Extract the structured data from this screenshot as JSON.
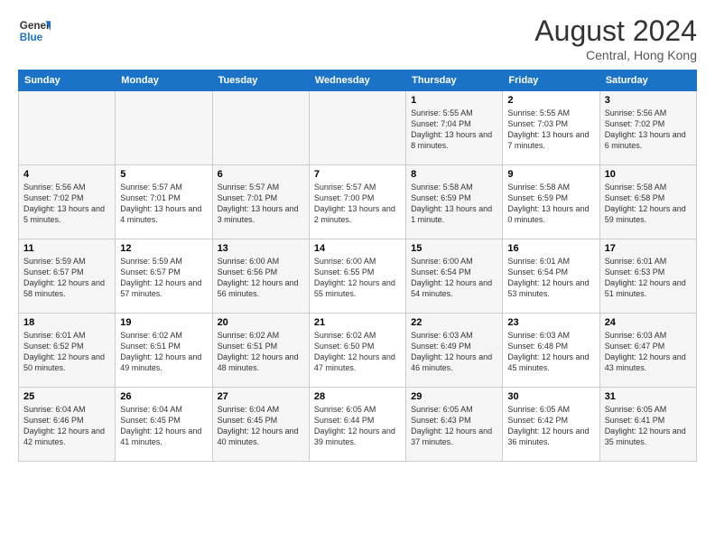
{
  "header": {
    "logo_line1": "General",
    "logo_line2": "Blue",
    "month": "August 2024",
    "location": "Central, Hong Kong"
  },
  "weekdays": [
    "Sunday",
    "Monday",
    "Tuesday",
    "Wednesday",
    "Thursday",
    "Friday",
    "Saturday"
  ],
  "weeks": [
    [
      {
        "day": "",
        "sunrise": "",
        "sunset": "",
        "daylight": ""
      },
      {
        "day": "",
        "sunrise": "",
        "sunset": "",
        "daylight": ""
      },
      {
        "day": "",
        "sunrise": "",
        "sunset": "",
        "daylight": ""
      },
      {
        "day": "",
        "sunrise": "",
        "sunset": "",
        "daylight": ""
      },
      {
        "day": "1",
        "sunrise": "Sunrise: 5:55 AM",
        "sunset": "Sunset: 7:04 PM",
        "daylight": "Daylight: 13 hours and 8 minutes."
      },
      {
        "day": "2",
        "sunrise": "Sunrise: 5:55 AM",
        "sunset": "Sunset: 7:03 PM",
        "daylight": "Daylight: 13 hours and 7 minutes."
      },
      {
        "day": "3",
        "sunrise": "Sunrise: 5:56 AM",
        "sunset": "Sunset: 7:02 PM",
        "daylight": "Daylight: 13 hours and 6 minutes."
      }
    ],
    [
      {
        "day": "4",
        "sunrise": "Sunrise: 5:56 AM",
        "sunset": "Sunset: 7:02 PM",
        "daylight": "Daylight: 13 hours and 5 minutes."
      },
      {
        "day": "5",
        "sunrise": "Sunrise: 5:57 AM",
        "sunset": "Sunset: 7:01 PM",
        "daylight": "Daylight: 13 hours and 4 minutes."
      },
      {
        "day": "6",
        "sunrise": "Sunrise: 5:57 AM",
        "sunset": "Sunset: 7:01 PM",
        "daylight": "Daylight: 13 hours and 3 minutes."
      },
      {
        "day": "7",
        "sunrise": "Sunrise: 5:57 AM",
        "sunset": "Sunset: 7:00 PM",
        "daylight": "Daylight: 13 hours and 2 minutes."
      },
      {
        "day": "8",
        "sunrise": "Sunrise: 5:58 AM",
        "sunset": "Sunset: 6:59 PM",
        "daylight": "Daylight: 13 hours and 1 minute."
      },
      {
        "day": "9",
        "sunrise": "Sunrise: 5:58 AM",
        "sunset": "Sunset: 6:59 PM",
        "daylight": "Daylight: 13 hours and 0 minutes."
      },
      {
        "day": "10",
        "sunrise": "Sunrise: 5:58 AM",
        "sunset": "Sunset: 6:58 PM",
        "daylight": "Daylight: 12 hours and 59 minutes."
      }
    ],
    [
      {
        "day": "11",
        "sunrise": "Sunrise: 5:59 AM",
        "sunset": "Sunset: 6:57 PM",
        "daylight": "Daylight: 12 hours and 58 minutes."
      },
      {
        "day": "12",
        "sunrise": "Sunrise: 5:59 AM",
        "sunset": "Sunset: 6:57 PM",
        "daylight": "Daylight: 12 hours and 57 minutes."
      },
      {
        "day": "13",
        "sunrise": "Sunrise: 6:00 AM",
        "sunset": "Sunset: 6:56 PM",
        "daylight": "Daylight: 12 hours and 56 minutes."
      },
      {
        "day": "14",
        "sunrise": "Sunrise: 6:00 AM",
        "sunset": "Sunset: 6:55 PM",
        "daylight": "Daylight: 12 hours and 55 minutes."
      },
      {
        "day": "15",
        "sunrise": "Sunrise: 6:00 AM",
        "sunset": "Sunset: 6:54 PM",
        "daylight": "Daylight: 12 hours and 54 minutes."
      },
      {
        "day": "16",
        "sunrise": "Sunrise: 6:01 AM",
        "sunset": "Sunset: 6:54 PM",
        "daylight": "Daylight: 12 hours and 53 minutes."
      },
      {
        "day": "17",
        "sunrise": "Sunrise: 6:01 AM",
        "sunset": "Sunset: 6:53 PM",
        "daylight": "Daylight: 12 hours and 51 minutes."
      }
    ],
    [
      {
        "day": "18",
        "sunrise": "Sunrise: 6:01 AM",
        "sunset": "Sunset: 6:52 PM",
        "daylight": "Daylight: 12 hours and 50 minutes."
      },
      {
        "day": "19",
        "sunrise": "Sunrise: 6:02 AM",
        "sunset": "Sunset: 6:51 PM",
        "daylight": "Daylight: 12 hours and 49 minutes."
      },
      {
        "day": "20",
        "sunrise": "Sunrise: 6:02 AM",
        "sunset": "Sunset: 6:51 PM",
        "daylight": "Daylight: 12 hours and 48 minutes."
      },
      {
        "day": "21",
        "sunrise": "Sunrise: 6:02 AM",
        "sunset": "Sunset: 6:50 PM",
        "daylight": "Daylight: 12 hours and 47 minutes."
      },
      {
        "day": "22",
        "sunrise": "Sunrise: 6:03 AM",
        "sunset": "Sunset: 6:49 PM",
        "daylight": "Daylight: 12 hours and 46 minutes."
      },
      {
        "day": "23",
        "sunrise": "Sunrise: 6:03 AM",
        "sunset": "Sunset: 6:48 PM",
        "daylight": "Daylight: 12 hours and 45 minutes."
      },
      {
        "day": "24",
        "sunrise": "Sunrise: 6:03 AM",
        "sunset": "Sunset: 6:47 PM",
        "daylight": "Daylight: 12 hours and 43 minutes."
      }
    ],
    [
      {
        "day": "25",
        "sunrise": "Sunrise: 6:04 AM",
        "sunset": "Sunset: 6:46 PM",
        "daylight": "Daylight: 12 hours and 42 minutes."
      },
      {
        "day": "26",
        "sunrise": "Sunrise: 6:04 AM",
        "sunset": "Sunset: 6:45 PM",
        "daylight": "Daylight: 12 hours and 41 minutes."
      },
      {
        "day": "27",
        "sunrise": "Sunrise: 6:04 AM",
        "sunset": "Sunset: 6:45 PM",
        "daylight": "Daylight: 12 hours and 40 minutes."
      },
      {
        "day": "28",
        "sunrise": "Sunrise: 6:05 AM",
        "sunset": "Sunset: 6:44 PM",
        "daylight": "Daylight: 12 hours and 39 minutes."
      },
      {
        "day": "29",
        "sunrise": "Sunrise: 6:05 AM",
        "sunset": "Sunset: 6:43 PM",
        "daylight": "Daylight: 12 hours and 37 minutes."
      },
      {
        "day": "30",
        "sunrise": "Sunrise: 6:05 AM",
        "sunset": "Sunset: 6:42 PM",
        "daylight": "Daylight: 12 hours and 36 minutes."
      },
      {
        "day": "31",
        "sunrise": "Sunrise: 6:05 AM",
        "sunset": "Sunset: 6:41 PM",
        "daylight": "Daylight: 12 hours and 35 minutes."
      }
    ]
  ]
}
